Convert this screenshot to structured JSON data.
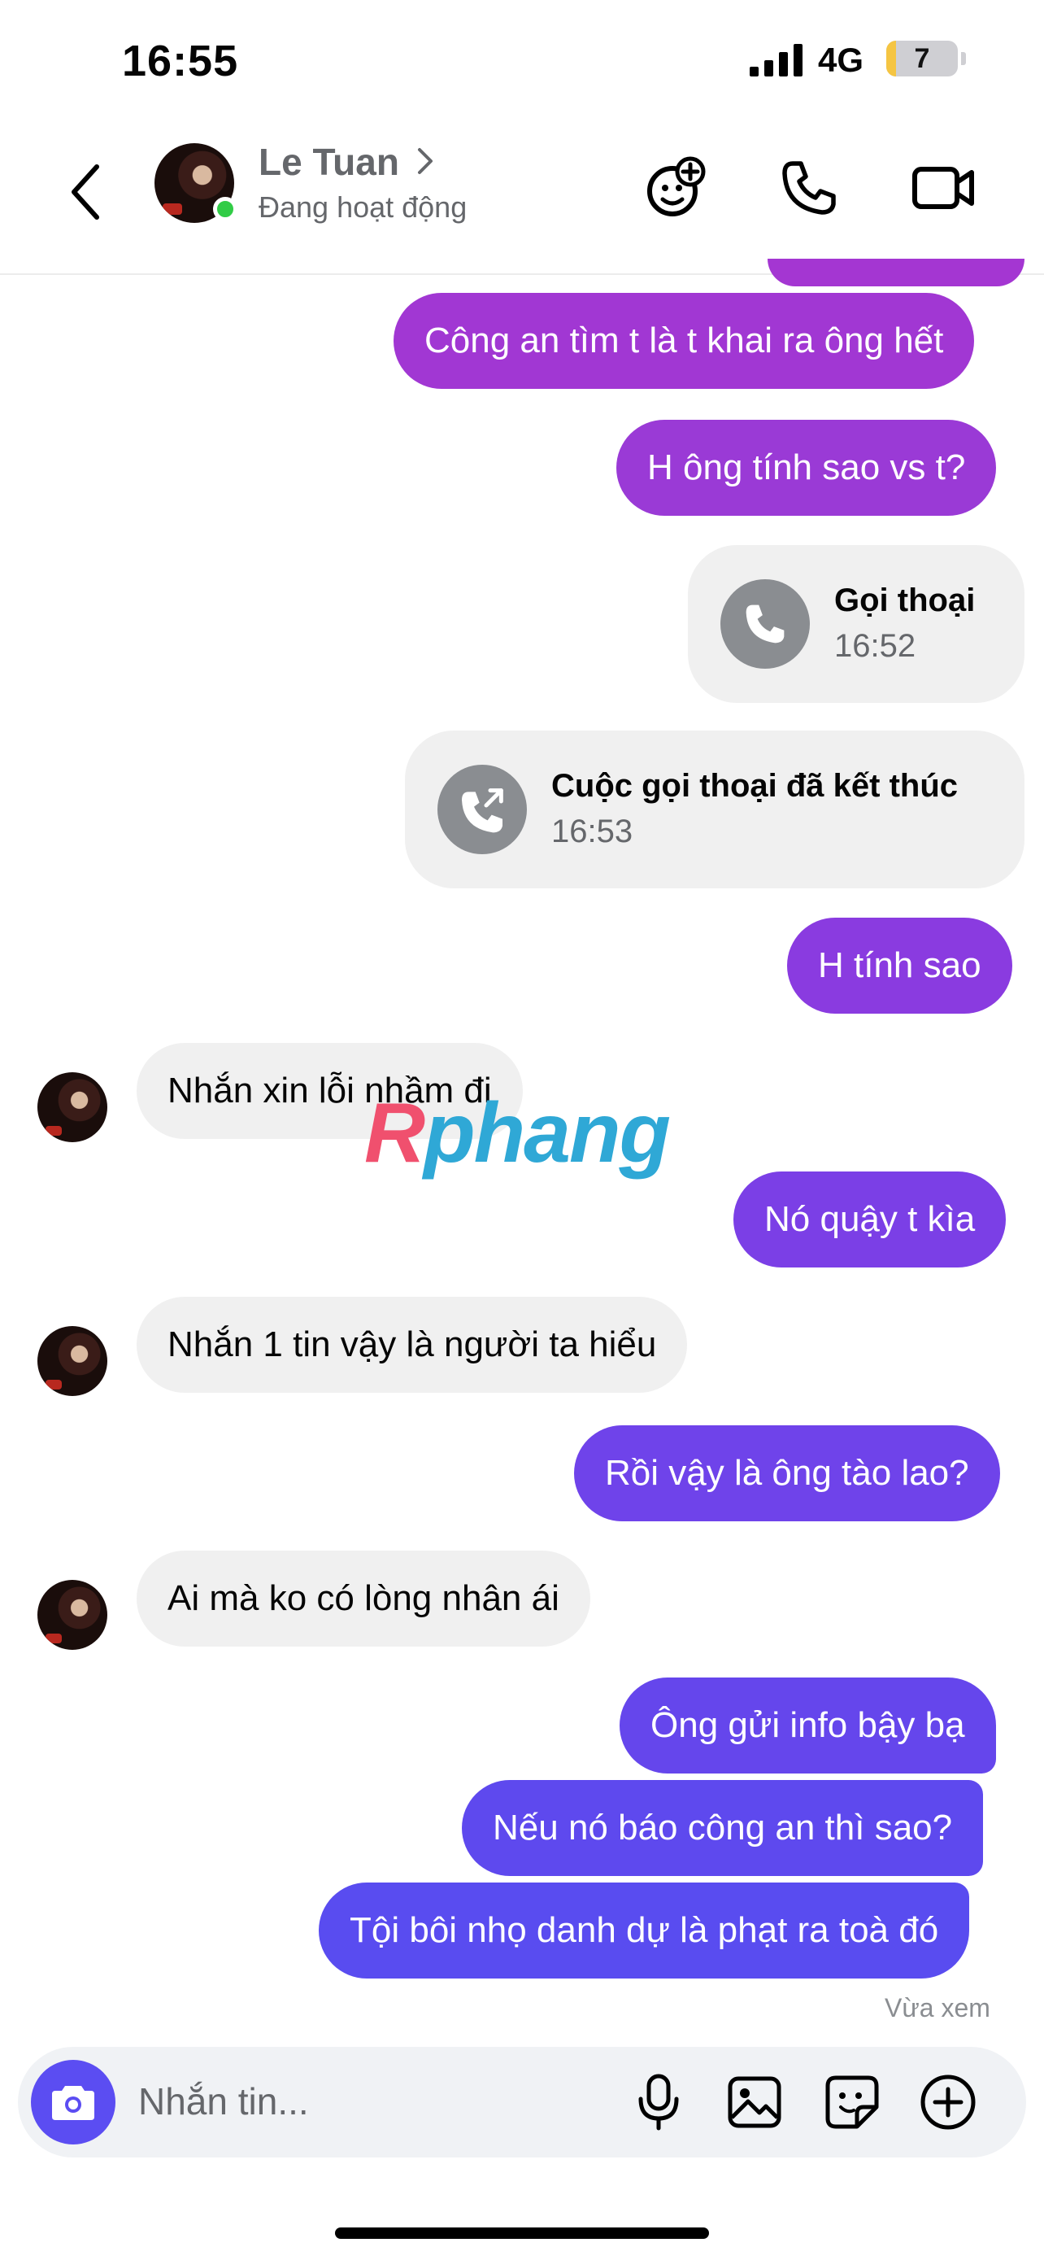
{
  "status_bar": {
    "time": "16:55",
    "network": "4G",
    "battery": "7",
    "battery_level": 0.07
  },
  "header": {
    "contact_name": "Le Tuan",
    "contact_status": "Đang hoạt động",
    "icons": [
      "back-arrow-icon",
      "add-emoji-icon",
      "phone-icon",
      "video-icon"
    ]
  },
  "messages": [
    {
      "from": "me",
      "text": "Công an tìm t là t khai ra ông hết"
    },
    {
      "from": "me",
      "text": "H ông tính sao vs t?"
    },
    {
      "from": "me",
      "type": "call",
      "title": "Gọi thoại",
      "time": "16:52"
    },
    {
      "from": "me",
      "type": "call",
      "title": "Cuộc gọi thoại đã kết thúc",
      "time": "16:53"
    },
    {
      "from": "me",
      "text": "H tính sao"
    },
    {
      "from": "them",
      "text": "Nhắn xin lỗi nhầm đi"
    },
    {
      "from": "me",
      "text": "Nó quậy t kìa"
    },
    {
      "from": "them",
      "text": "Nhắn 1 tin vậy là người ta hiểu"
    },
    {
      "from": "me",
      "text": "Rồi vậy là ông tào lao?"
    },
    {
      "from": "them",
      "text": "Ai mà ko có lòng nhân ái"
    },
    {
      "from": "me",
      "text": "Ông gửi info bậy bạ"
    },
    {
      "from": "me",
      "text": "Nếu nó báo công an thì sao?"
    },
    {
      "from": "me",
      "text": "Tội bôi nhọ danh dự là phạt ra toà đó"
    }
  ],
  "seen_label": "Vừa xem",
  "watermark": {
    "first": "R",
    "rest": "phang"
  },
  "composer": {
    "placeholder": "Nhắn tin...",
    "icons": [
      "camera-icon",
      "microphone-icon",
      "image-icon",
      "sticker-icon",
      "plus-icon"
    ]
  },
  "colors": {
    "accent": "#5b4df2",
    "bubble_top": "#a535d3",
    "bubble_bottom": "#5a4ef0",
    "incoming_bubble": "#f0f0f0",
    "online": "#31cc46"
  }
}
